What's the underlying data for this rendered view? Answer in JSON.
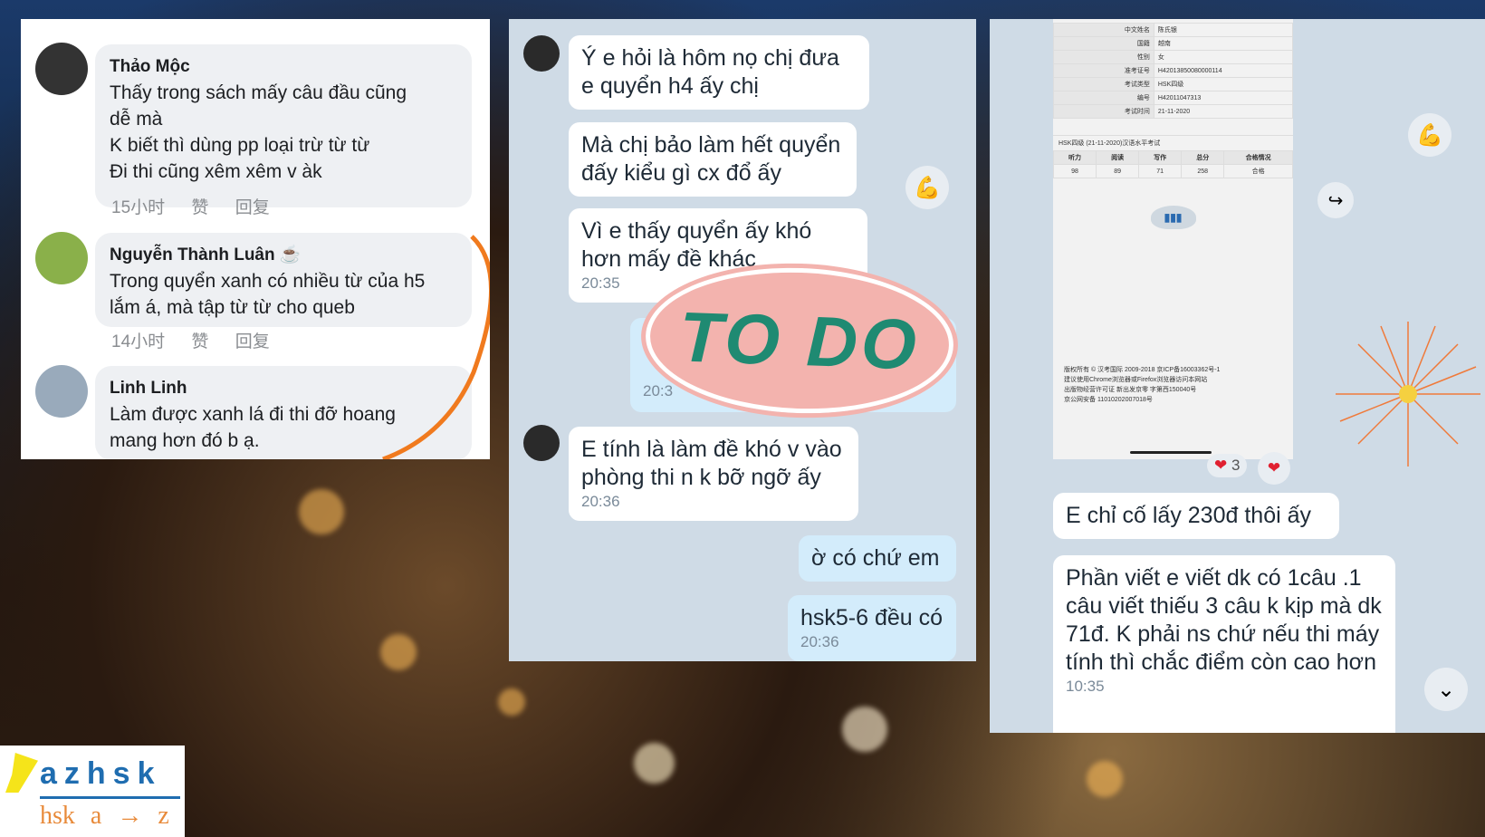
{
  "comments": [
    {
      "name": "Thảo Mộc",
      "text": [
        "Thấy trong sách mấy câu đầu cũng",
        "dễ mà",
        "K biết thì dùng pp loại trừ từ từ",
        "Đi thi cũng xêm xêm v àk"
      ],
      "time": "15小时",
      "like": "赞",
      "reply": "回复"
    },
    {
      "name": "Nguyễn Thành Luân ☕",
      "text": [
        "Trong quyển xanh có nhiều từ của h5",
        "lắm á, mà tập từ từ cho queb"
      ],
      "time": "14小时",
      "like": "赞",
      "reply": "回复"
    },
    {
      "name": "Linh Linh",
      "text": [
        "Làm được xanh lá đi thi đỡ hoang",
        "mang hơn đó b ạ."
      ]
    }
  ],
  "chat1": [
    {
      "text": "Ý e hỏi là hôm nọ chị đưa e quyển h4 ấy chị"
    },
    {
      "text": "Mà chị bảo làm hết quyển đấy kiểu gì cx đổ ấy"
    },
    {
      "text": "Vì e thấy quyển ấy khó hơn mấy đề khác",
      "time": "20:35"
    },
    {
      "time": "20:3"
    },
    {
      "text": "E tính là làm đề khó v vào phòng thi n k bỡ ngỡ ấy",
      "time": "20:36"
    },
    {
      "text": "ờ có chứ em"
    },
    {
      "text": "hsk5-6 đều có",
      "time": "20:36"
    }
  ],
  "stamp": "TO DO",
  "score_card": {
    "info": [
      [
        "中文姓名",
        "陈氏银"
      ],
      [
        "国籍",
        "越南"
      ],
      [
        "性别",
        "女"
      ],
      [
        "准考证号",
        "H42013850080000114"
      ],
      [
        "考试类型",
        "HSK四级"
      ],
      [
        "编号",
        "H42011047313"
      ],
      [
        "考试时间",
        "21-11-2020"
      ]
    ],
    "exam_title": "HSK四级 (21-11-2020)汉语水平考试",
    "headers": [
      "听力",
      "阅读",
      "写作",
      "总分",
      "合格情况"
    ],
    "scores": [
      "98",
      "89",
      "71",
      "258",
      "合格"
    ],
    "footer": [
      "版权所有 © 汉考国际 2009-2018 京ICP备16003362号-1",
      "建议使用Chrome浏览器或Firefox浏览器访问本网站",
      "出版物经营许可证 新出发京零 字第西150040号",
      "京公网安备 11010202007018号"
    ]
  },
  "reactions": {
    "heart_count": "3"
  },
  "chat2": [
    {
      "text": "E chỉ cố lấy 230đ thôi ấy"
    },
    {
      "text": "Phần viết e viết dk có 1câu .1 câu viết thiếu 3 câu k kịp mà dk 71đ. K phải ns chứ nếu thi máy tính thì chắc điểm còn cao hơn",
      "time": "10:35"
    }
  ],
  "logo": {
    "top": "azhsk",
    "bottom": "hsk a → z"
  },
  "colors": {
    "accent_green": "#1f8a72",
    "stamp_pink": "#f3b3ae",
    "orange_line": "#f07a1e"
  }
}
